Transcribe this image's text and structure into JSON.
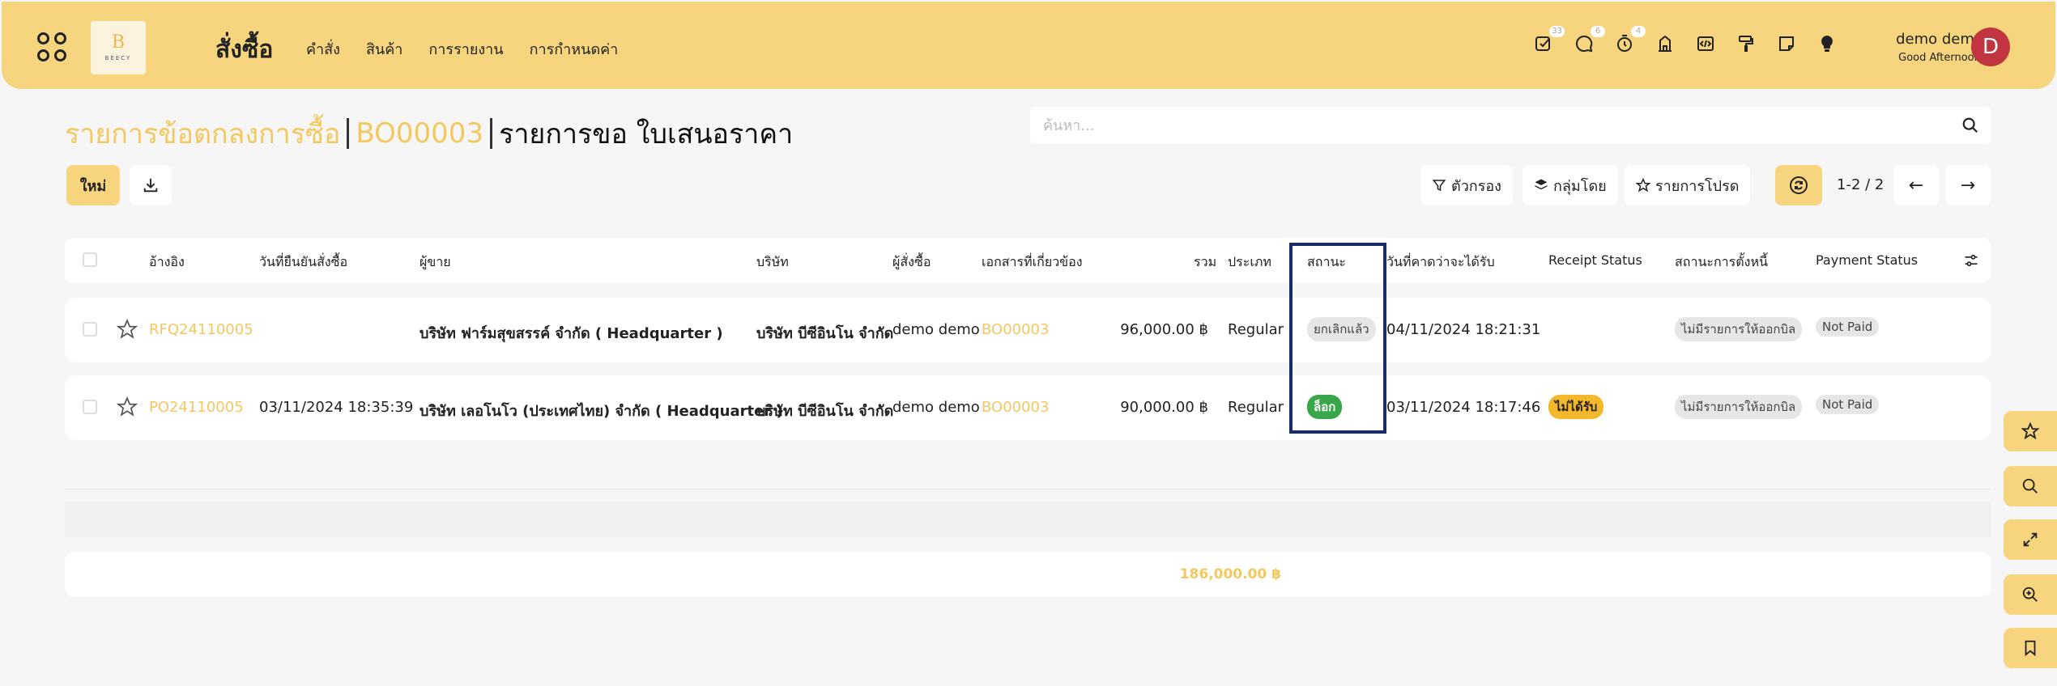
{
  "app": {
    "title": "สั่งซื้อ",
    "logo_letter": "B",
    "logo_text": "BEECY",
    "menu": [
      "คำสั่ง",
      "สินค้า",
      "การรายงาน",
      "การกำหนดค่า"
    ]
  },
  "systray": {
    "badges": {
      "activity": "33",
      "messages": "6",
      "timer": "4"
    }
  },
  "user": {
    "name": "demo demo",
    "greeting": "Good Afternoon",
    "initial": "D"
  },
  "breadcrumb": {
    "items": [
      "รายการข้อตกลงการซื้อ",
      "BO00003"
    ],
    "current": "รายการขอ ใบเสนอราคา"
  },
  "search": {
    "placeholder": "ค้นหา..."
  },
  "toolbar": {
    "new_label": "ใหม่",
    "filter_label": "ตัวกรอง",
    "group_label": "กลุ่มโดย",
    "favorites_label": "รายการโปรด",
    "pager": "1-2 / 2"
  },
  "table": {
    "columns": {
      "reference": "อ้างอิง",
      "confirm_date": "วันที่ยืนยันสั่งซื้อ",
      "vendor": "ผู้ขาย",
      "company": "บริษัท",
      "buyer": "ผู้สั่งซื้อ",
      "source_doc": "เอกสารที่เกี่ยวข้อง",
      "total": "รวม",
      "type": "ประเภท",
      "status": "สถานะ",
      "expected_date": "วันที่คาดว่าจะได้รับ",
      "receipt_status": "Receipt Status",
      "billing_status": "สถานะการตั้งหนี้",
      "payment_status": "Payment Status"
    },
    "rows": [
      {
        "reference": "RFQ24110005",
        "confirm_date": "",
        "vendor": "บริษัท ฟาร์มสุขสรรค์ จำกัด ( Headquarter )",
        "company": "บริษัท บีซีอินโน จำกัด",
        "buyer": "demo demo",
        "source_doc": "BO00003",
        "total": "96,000.00 ฿",
        "type": "Regular",
        "status": "ยกเลิกแล้ว",
        "expected_date": "04/11/2024 18:21:31",
        "receipt_status": "",
        "billing_status": "ไม่มีรายการให้ออกบิล",
        "payment_status": "Not Paid"
      },
      {
        "reference": "PO24110005",
        "confirm_date": "03/11/2024 18:35:39",
        "vendor": "บริษัท เลอโนโว (ประเทศไทย) จำกัด ( Headquarter )",
        "company": "บริษัท บีซีอินโน จำกัด",
        "buyer": "demo demo",
        "source_doc": "BO00003",
        "total": "90,000.00 ฿",
        "type": "Regular",
        "status": "ล็อก",
        "expected_date": "03/11/2024 18:17:46",
        "receipt_status": "ไม่ได้รับ",
        "billing_status": "ไม่มีรายการให้ออกบิล",
        "payment_status": "Not Paid"
      }
    ],
    "footer_total": "186,000.00 ฿"
  },
  "colors": {
    "brand": "#f6d57e",
    "link": "#f3c85f",
    "avatar": "#c0353f",
    "status_locked": "#3aa64a",
    "receipt_not_received": "#f4b82b",
    "highlight_box": "#1a2b6b"
  }
}
